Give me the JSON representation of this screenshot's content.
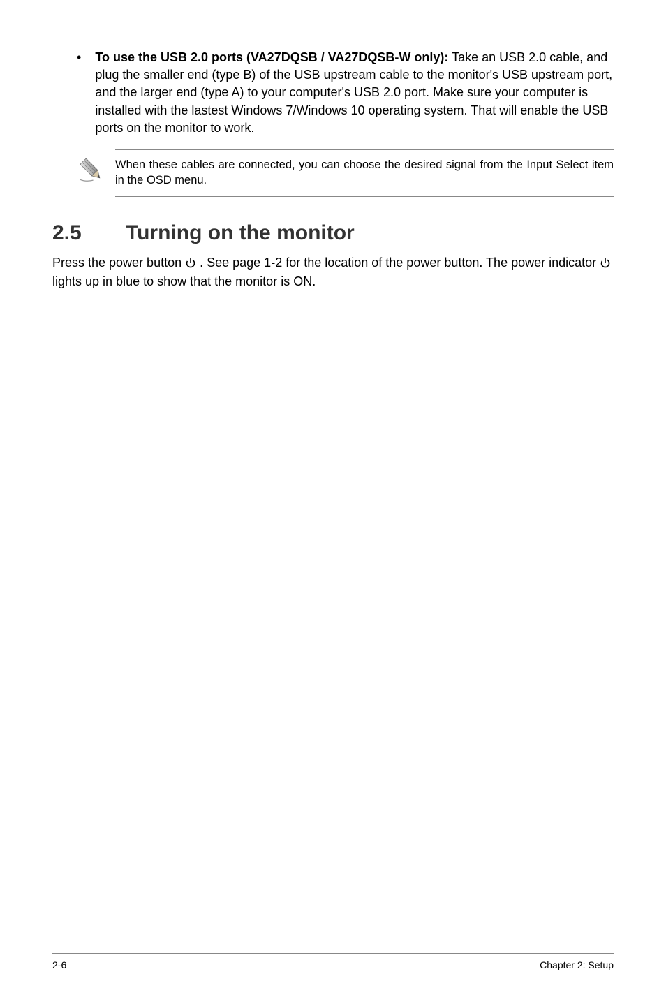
{
  "bullet": {
    "bold_lead": "To use the USB 2.0 ports (VA27DQSB / VA27DQSB-W only):",
    "rest": " Take an USB 2.0 cable, and plug the smaller end (type B) of the USB upstream cable to the monitor's USB upstream port, and the larger end (type A) to your computer's USB 2.0 port. Make sure your computer is installed with the lastest Windows 7/Windows 10 operating system. That will enable the USB ports on the monitor to work."
  },
  "note": {
    "text": "When these cables are connected, you can choose the desired signal from the Input Select item in the OSD menu."
  },
  "section": {
    "number": "2.5",
    "title": "Turning on the monitor"
  },
  "body": {
    "part1": "Press the power button ",
    "part2": " . See page 1-2 for the location of the power button. The power indicator ",
    "part3": " lights up in blue to show that the monitor is ON."
  },
  "footer": {
    "page": "2-6",
    "chapter": "Chapter 2: Setup"
  }
}
